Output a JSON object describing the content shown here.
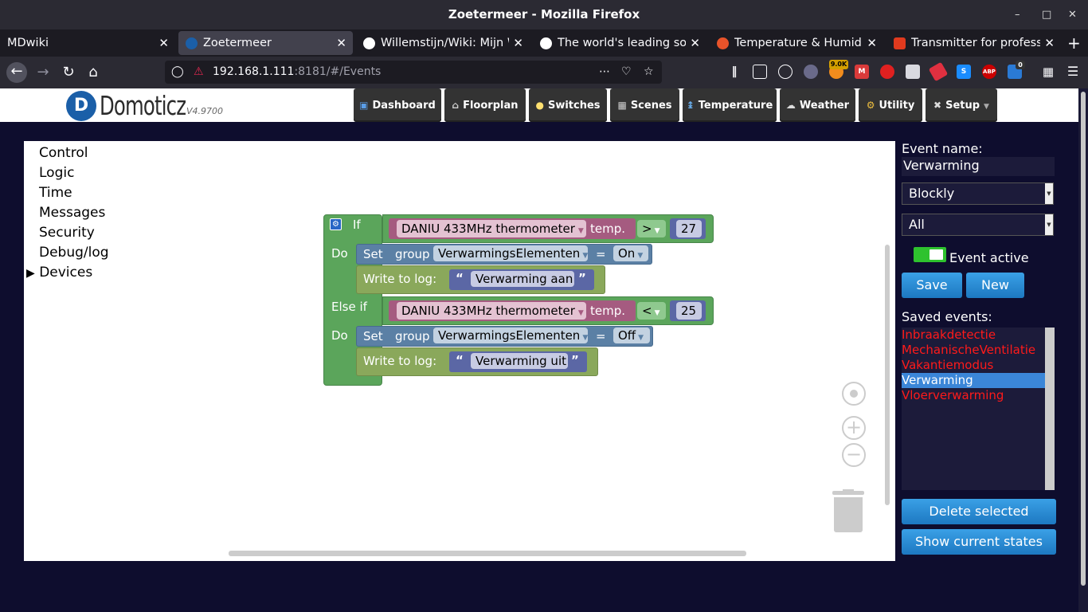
{
  "window": {
    "title": "Zoetermeer - Mozilla Firefox",
    "min": "–",
    "max": "□",
    "close": "✕"
  },
  "tabs": [
    {
      "label": "MDwiki",
      "close": "✕"
    },
    {
      "label": "Zoetermeer",
      "close": "✕"
    },
    {
      "label": "Willemstijn/Wiki: Mijn W",
      "close": "✕"
    },
    {
      "label": "The world's leading soft",
      "close": "✕"
    },
    {
      "label": "Temperature & Humidity",
      "close": "✕"
    },
    {
      "label": "Transmitter for profess",
      "close": "✕"
    }
  ],
  "new_tab": "+",
  "address": {
    "host": "192.168.1.111",
    "rest": ":8181/#/Events"
  },
  "toolbar_badges": {
    "rss": "9.0K",
    "abp": "ABP",
    "counter": "0"
  },
  "app": {
    "logo_text": "Domoticz",
    "version": "V4.9700",
    "menu": [
      "Dashboard",
      "Floorplan",
      "Switches",
      "Scenes",
      "Temperature",
      "Weather",
      "Utility",
      "Setup"
    ]
  },
  "categories": [
    "Control",
    "Logic",
    "Time",
    "Messages",
    "Security",
    "Debug/log",
    "Devices"
  ],
  "blockly": {
    "if": "If",
    "do": "Do",
    "else_if": "Else if",
    "device": "DANIU 433MHz thermometer",
    "temp": "temp.",
    "op1": ">",
    "val1": "27",
    "op2": "<",
    "val2": "25",
    "set": "Set",
    "group": "group",
    "group_name": "VerwarmingsElementen",
    "eq": "=",
    "on": "On",
    "off": "Off",
    "write_log": "Write to log:",
    "msg_on": "Verwarming aan",
    "msg_off": "Verwarming uit",
    "quote_open": "“",
    "quote_close": "”"
  },
  "panel": {
    "event_name_label": "Event name:",
    "event_name": "Verwarming",
    "type": "Blockly",
    "filter": "All",
    "active_label": "Event active",
    "save": "Save",
    "new": "New",
    "saved_label": "Saved events:",
    "saved": [
      "Inbraakdetectie",
      "MechanischeVentilatie",
      "Vakantiemodus",
      "Verwarming",
      "Vloerverwarming"
    ],
    "delete": "Delete selected",
    "states": "Show current states"
  }
}
